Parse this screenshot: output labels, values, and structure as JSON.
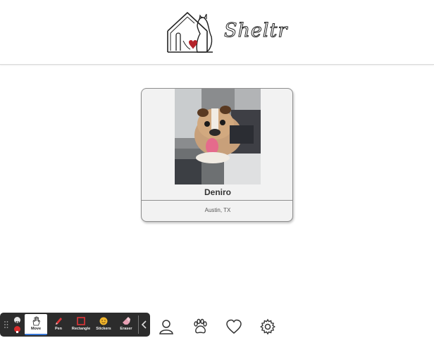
{
  "header": {
    "logo_text": "Sheltr"
  },
  "pet_card": {
    "name": "Deniro",
    "location": "Austin, TX"
  },
  "recording_toolbar": {
    "tools": [
      {
        "label": "Move"
      },
      {
        "label": "Pen"
      },
      {
        "label": "Rectangle"
      },
      {
        "label": "Stickers"
      },
      {
        "label": "Eraser"
      }
    ]
  },
  "bottom_nav": {
    "icons": [
      "user-icon",
      "paw-icon",
      "heart-icon",
      "gear-icon"
    ]
  },
  "colors": {
    "card_background": "#f2f2f2",
    "card_border": "#8e8e8e",
    "logo_heart": "#b4232a",
    "toolbar_background": "#2c2c2c",
    "stop_red": "#d92c2c"
  }
}
